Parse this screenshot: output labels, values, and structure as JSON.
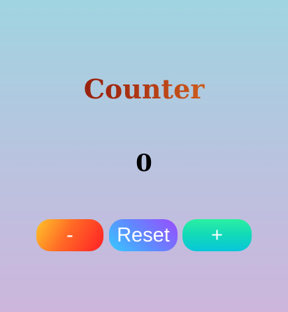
{
  "app": {
    "title": "Counter"
  },
  "counter": {
    "value": "0"
  },
  "buttons": {
    "decrement_label": "-",
    "reset_label": "Reset",
    "increment_label": "+"
  },
  "colors": {
    "background_top": "#a0d4e1",
    "background_bottom": "#cdb5dc",
    "title_gradient_start": "#7a0d0d",
    "title_gradient_end": "#e98a2f",
    "decrement_gradient": [
      "#ffc429",
      "#ff1f25"
    ],
    "reset_gradient": [
      "#37c9ff",
      "#9b4bff"
    ],
    "increment_gradient": [
      "#2bf0a1",
      "#08c6da"
    ]
  }
}
